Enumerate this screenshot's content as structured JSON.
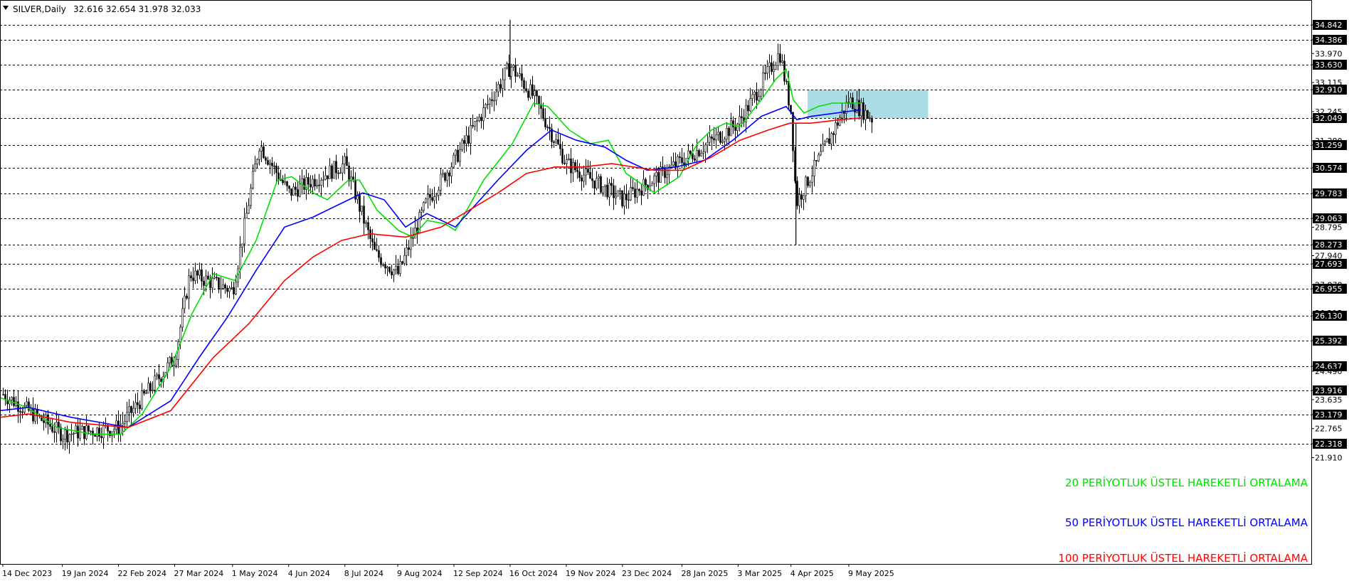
{
  "header": {
    "symbol_label": "SILVER,Daily",
    "ohlc": "32.616 32.654 31.978 32.033",
    "menu_icon": "triangle-down-icon"
  },
  "colors": {
    "background": "#ffffff",
    "candles": "#000000",
    "ema20": "#00e000",
    "ema50": "#0000ff",
    "ema100": "#ff0000",
    "zone_fill": "#aadde6",
    "level_line": "#000000"
  },
  "chart_data": {
    "type": "line",
    "title": "SILVER,Daily",
    "ylim": [
      21.6,
      35.2
    ],
    "grid": false,
    "x_ticks": [
      "14 Dec 2023",
      "19 Jan 2024",
      "22 Feb 2024",
      "27 Mar 2024",
      "1 May 2024",
      "4 Jun 2024",
      "8 Jul 2024",
      "9 Aug 2024",
      "12 Sep 2024",
      "16 Oct 2024",
      "19 Nov 2024",
      "23 Dec 2024",
      "28 Jan 2025",
      "3 Mar 2025",
      "4 Apr 2025",
      "9 May 2025"
    ],
    "y_ticks": [
      "34.842",
      "34.386",
      "33.970",
      "33.630",
      "33.115",
      "32.910",
      "32.245",
      "32.049",
      "31.380",
      "31.259",
      "30.574",
      "29.783",
      "29.063",
      "28.795",
      "28.273",
      "27.940",
      "27.693",
      "27.070",
      "26.955",
      "26.215",
      "26.130",
      "25.392",
      "24.637",
      "24.490",
      "23.916",
      "23.635",
      "23.179",
      "22.765",
      "22.318",
      "21.910"
    ],
    "levels": [
      34.842,
      34.386,
      33.63,
      32.91,
      32.049,
      31.259,
      30.574,
      29.783,
      29.063,
      28.273,
      27.693,
      26.955,
      26.13,
      25.392,
      24.637,
      23.916,
      23.179,
      22.318
    ],
    "last_price": 32.033,
    "zone": {
      "x_start": "14 Apr 2025",
      "x_end": "26 Jun 2025",
      "y_low": 32.049,
      "y_high": 32.91
    },
    "candles": [
      [
        "14 Dec 2023",
        23.8
      ],
      [
        "19 Jan 2024",
        22.6
      ],
      [
        "22 Feb 2024",
        22.8
      ],
      [
        "27 Mar 2024",
        24.9
      ],
      [
        "5 Apr 2024",
        27.4
      ],
      [
        "1 May 2024",
        26.9
      ],
      [
        "17 May 2024",
        31.3
      ],
      [
        "4 Jun 2024",
        29.8
      ],
      [
        "8 Jul 2024",
        30.7
      ],
      [
        "26 Jul 2024",
        28.0
      ],
      [
        "9 Aug 2024",
        27.4
      ],
      [
        "26 Aug 2024",
        29.5
      ],
      [
        "12 Sep 2024",
        30.8
      ],
      [
        "16 Oct 2024",
        33.6
      ],
      [
        "30 Oct 2024",
        32.7
      ],
      [
        "19 Nov 2024",
        30.7
      ],
      [
        "23 Dec 2024",
        29.6
      ],
      [
        "28 Jan 2025",
        30.8
      ],
      [
        "3 Mar 2025",
        31.9
      ],
      [
        "28 Mar 2025",
        34.0
      ],
      [
        "7 Apr 2025",
        29.5
      ],
      [
        "4 Apr 2025",
        32.2
      ],
      [
        "9 May 2025",
        32.6
      ],
      [
        "23 May 2025",
        32.033
      ]
    ],
    "series": [
      {
        "name": "20 PERİYOTLUK ÜSTEL HAREKETLİ ORTALAMA",
        "color": "#00e000",
        "values": [
          [
            0,
            23.7
          ],
          [
            38,
            23.4
          ],
          [
            80,
            22.8
          ],
          [
            130,
            22.6
          ],
          [
            170,
            22.6
          ],
          [
            200,
            23.2
          ],
          [
            240,
            24.6
          ],
          [
            270,
            26.2
          ],
          [
            300,
            27.4
          ],
          [
            330,
            27.2
          ],
          [
            360,
            28.4
          ],
          [
            390,
            30.2
          ],
          [
            410,
            30.3
          ],
          [
            440,
            29.8
          ],
          [
            460,
            29.6
          ],
          [
            490,
            30.2
          ],
          [
            505,
            30.2
          ],
          [
            530,
            29.3
          ],
          [
            560,
            28.7
          ],
          [
            580,
            28.5
          ],
          [
            600,
            29.0
          ],
          [
            625,
            28.9
          ],
          [
            640,
            28.7
          ],
          [
            680,
            30.2
          ],
          [
            720,
            31.3
          ],
          [
            750,
            32.5
          ],
          [
            770,
            32.4
          ],
          [
            800,
            31.7
          ],
          [
            830,
            31.3
          ],
          [
            855,
            31.4
          ],
          [
            880,
            30.4
          ],
          [
            920,
            29.8
          ],
          [
            955,
            30.3
          ],
          [
            980,
            31.3
          ],
          [
            1000,
            31.7
          ],
          [
            1020,
            31.9
          ],
          [
            1040,
            31.8
          ],
          [
            1070,
            32.6
          ],
          [
            1090,
            33.2
          ],
          [
            1105,
            33.5
          ],
          [
            1115,
            32.6
          ],
          [
            1130,
            32.2
          ],
          [
            1150,
            32.4
          ],
          [
            1170,
            32.5
          ],
          [
            1210,
            32.5
          ]
        ]
      },
      {
        "name": "50 PERİYOTLUK ÜSTEL HAREKETLİ ORTALAMA",
        "color": "#0000ff",
        "values": [
          [
            0,
            23.3
          ],
          [
            40,
            23.4
          ],
          [
            100,
            23.1
          ],
          [
            180,
            22.8
          ],
          [
            240,
            23.6
          ],
          [
            280,
            24.9
          ],
          [
            320,
            26.1
          ],
          [
            360,
            27.5
          ],
          [
            400,
            28.8
          ],
          [
            440,
            29.1
          ],
          [
            470,
            29.4
          ],
          [
            510,
            29.8
          ],
          [
            540,
            29.6
          ],
          [
            570,
            28.8
          ],
          [
            600,
            29.2
          ],
          [
            640,
            28.8
          ],
          [
            700,
            30.2
          ],
          [
            740,
            31.1
          ],
          [
            775,
            31.7
          ],
          [
            810,
            31.4
          ],
          [
            850,
            31.2
          ],
          [
            880,
            30.8
          ],
          [
            910,
            30.5
          ],
          [
            950,
            30.6
          ],
          [
            990,
            30.8
          ],
          [
            1030,
            31.4
          ],
          [
            1070,
            32.1
          ],
          [
            1105,
            32.4
          ],
          [
            1120,
            32.0
          ],
          [
            1140,
            32.1
          ],
          [
            1210,
            32.3
          ]
        ]
      },
      {
        "name": "100 PERİYOTLUK ÜSTEL HAREKETLİ ORTALAMA",
        "color": "#ff0000",
        "values": [
          [
            0,
            23.1
          ],
          [
            40,
            23.2
          ],
          [
            100,
            22.95
          ],
          [
            180,
            22.8
          ],
          [
            240,
            23.3
          ],
          [
            300,
            24.9
          ],
          [
            350,
            25.9
          ],
          [
            400,
            27.2
          ],
          [
            440,
            27.9
          ],
          [
            480,
            28.4
          ],
          [
            520,
            28.6
          ],
          [
            570,
            28.5
          ],
          [
            620,
            28.8
          ],
          [
            700,
            29.8
          ],
          [
            740,
            30.4
          ],
          [
            780,
            30.6
          ],
          [
            820,
            30.6
          ],
          [
            860,
            30.7
          ],
          [
            920,
            30.5
          ],
          [
            960,
            30.5
          ],
          [
            1000,
            30.9
          ],
          [
            1040,
            31.4
          ],
          [
            1080,
            31.7
          ],
          [
            1110,
            31.9
          ],
          [
            1140,
            31.9
          ],
          [
            1180,
            32.0
          ],
          [
            1210,
            32.05
          ]
        ]
      }
    ],
    "legend": [
      {
        "label": "20 PERİYOTLUK ÜSTEL HAREKETLİ ORTALAMA",
        "color": "#00e000"
      },
      {
        "label": "50 PERİYOTLUK ÜSTEL HAREKETLİ ORTALAMA",
        "color": "#0000ff"
      },
      {
        "label": "100 PERİYOTLUK ÜSTEL HAREKETLİ ORTALAMA",
        "color": "#ff0000"
      }
    ],
    "legend_position": "bottom-right"
  }
}
